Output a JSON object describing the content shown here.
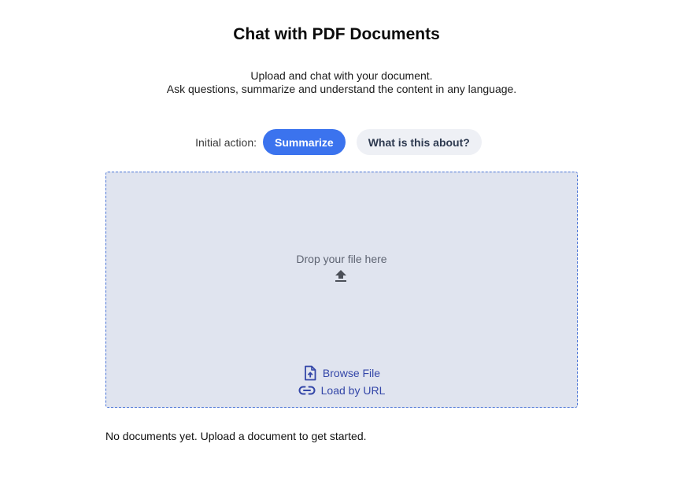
{
  "header": {
    "title": "Chat with PDF Documents",
    "subtitle_line1": "Upload and chat with your document.",
    "subtitle_line2": "Ask questions, summarize and understand the content in any language."
  },
  "initial_action": {
    "label": "Initial action:",
    "options": [
      "Summarize",
      "What is this about?"
    ],
    "selected": "Summarize"
  },
  "dropzone": {
    "text": "Drop your file here",
    "icon": "upload-icon",
    "browse_label": "Browse File",
    "browse_icon": "file-upload-icon",
    "url_label": "Load by URL",
    "url_icon": "link-icon"
  },
  "documents": {
    "empty_text": "No documents yet. Upload a document to get started."
  },
  "colors": {
    "primary": "#3b73ee",
    "secondary_pill": "#eef0f5",
    "dropzone_bg": "#e0e4ef",
    "dropzone_border": "#4a74d6",
    "link": "#3346a8"
  }
}
